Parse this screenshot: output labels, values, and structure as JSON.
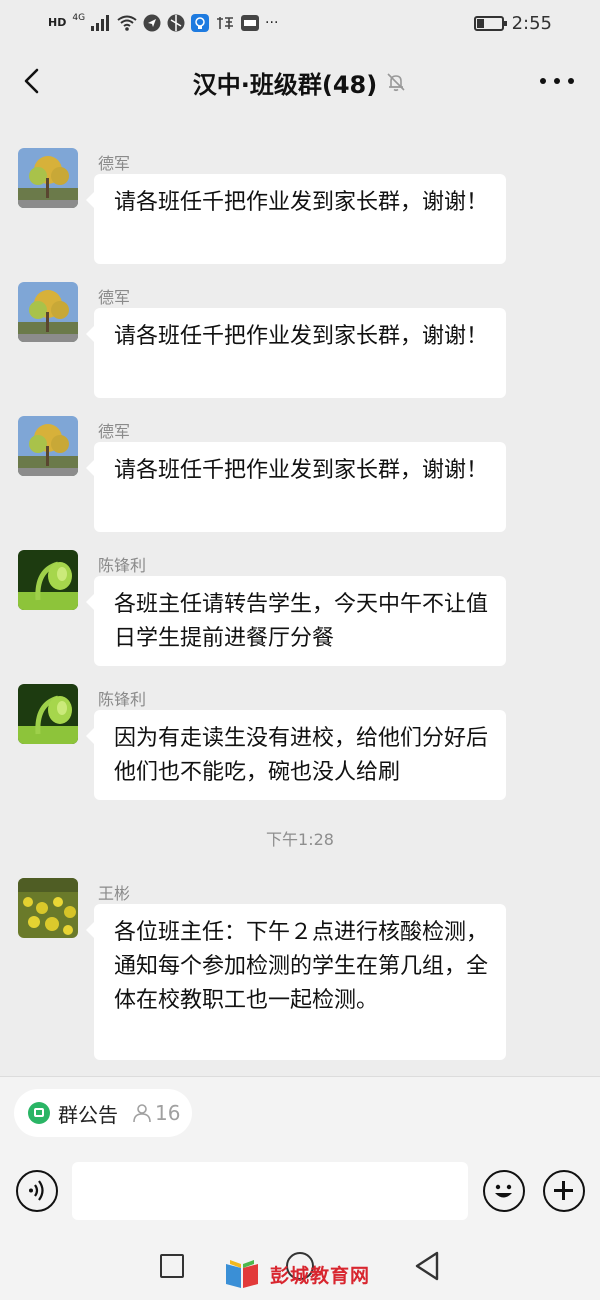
{
  "status_bar": {
    "hd": "HD",
    "network": "4G",
    "time": "2:55",
    "battery_level": 0.3
  },
  "header": {
    "title": "汉中·班级群(48)",
    "back_icon": "chevron-left-icon",
    "mute_icon": "bell-muted-icon",
    "more_icon": "more-dots-icon"
  },
  "messages": [
    {
      "sender": "德军",
      "text": "请各班任千把作业发到家长群，谢谢！",
      "avatar": "tree-photo"
    },
    {
      "sender": "德军",
      "text": "请各班任千把作业发到家长群，谢谢！",
      "avatar": "tree-photo"
    },
    {
      "sender": "德军",
      "text": "请各班任千把作业发到家长群，谢谢！",
      "avatar": "tree-photo"
    },
    {
      "sender": "陈锋利",
      "text": "各班主任请转告学生，今天中午不让值日学生提前进餐厅分餐",
      "avatar": "sprout-photo"
    },
    {
      "sender": "陈锋利",
      "text": "因为有走读生没有进校，给他们分好后他们也不能吃，碗也没人给刷",
      "avatar": "sprout-photo"
    },
    {
      "sender": "王彬",
      "text": "各位班主任：下午２点进行核酸检测，通知每个参加检测的学生在第几组，全体在校教职工也一起检测。",
      "avatar": "flower-field-photo"
    }
  ],
  "timestamp": "下午1:28",
  "group_notice": {
    "label": "群公告",
    "count": "16",
    "icon": "notice-icon"
  },
  "input": {
    "placeholder": "",
    "voice_icon": "voice-icon",
    "emoji_icon": "emoji-icon",
    "plus_icon": "plus-icon"
  },
  "watermark": {
    "text": "彭城教育网"
  }
}
